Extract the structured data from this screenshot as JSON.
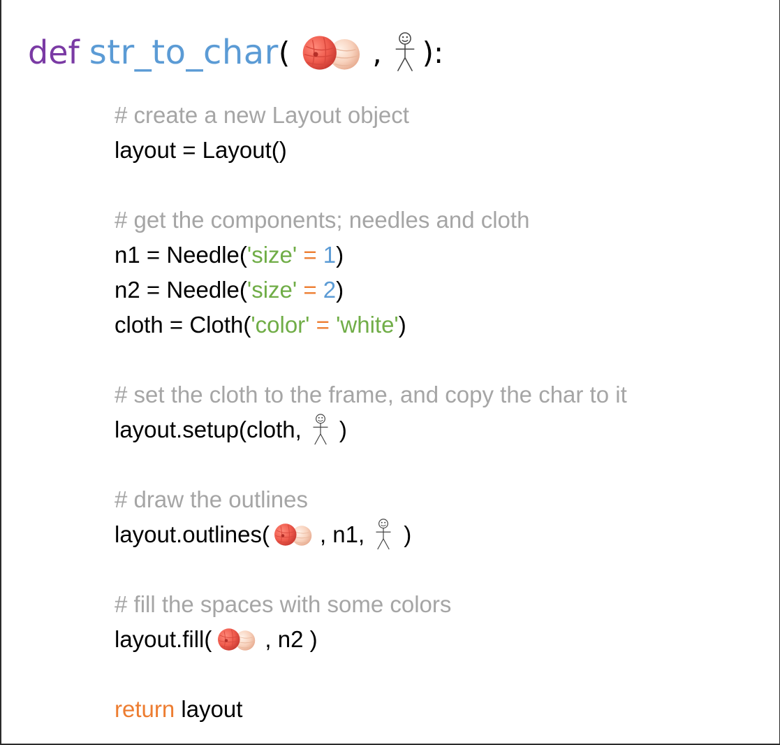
{
  "header": {
    "def": "def",
    "name": "str_to_char",
    "open_paren": "(",
    "comma": ",",
    "close": "):"
  },
  "lines": {
    "c1": "# create a new Layout object",
    "l1": "layout = Layout()",
    "c2": "# get the components; needles and cloth",
    "n1_prefix": "n1 = Needle(",
    "n1_key": "'size'",
    "n1_eq": " = ",
    "n1_val": "1",
    "n1_close": ")",
    "n2_prefix": "n2 = Needle(",
    "n2_key": "'size'",
    "n2_eq": " = ",
    "n2_val": "2",
    "n2_close": ")",
    "cloth_prefix": "cloth = Cloth(",
    "cloth_key": "'color'",
    "cloth_eq": " = ",
    "cloth_val": "'white'",
    "cloth_close": ")",
    "c3": "# set the cloth to the frame, and copy the char to it",
    "setup_prefix": "layout.setup(cloth,",
    "setup_close": ")",
    "c4": "# draw the outlines",
    "outlines_prefix": "layout.outlines(",
    "outlines_mid": ", n1,",
    "outlines_close": ")",
    "c5": "# fill the spaces with some colors",
    "fill_prefix": "layout.fill(",
    "fill_mid": ", n2 )",
    "return_kw": "return",
    "return_val": " layout"
  },
  "icons": {
    "yarn": "yarn-balls-icon",
    "stick": "stick-figure-icon"
  },
  "colors": {
    "def": "#7a3aa4",
    "function_name": "#5b9bd5",
    "comment": "#a5a5a5",
    "string": "#70ad47",
    "operator": "#ed7d31",
    "number": "#5b9bd5",
    "keyword": "#ed7d31"
  }
}
